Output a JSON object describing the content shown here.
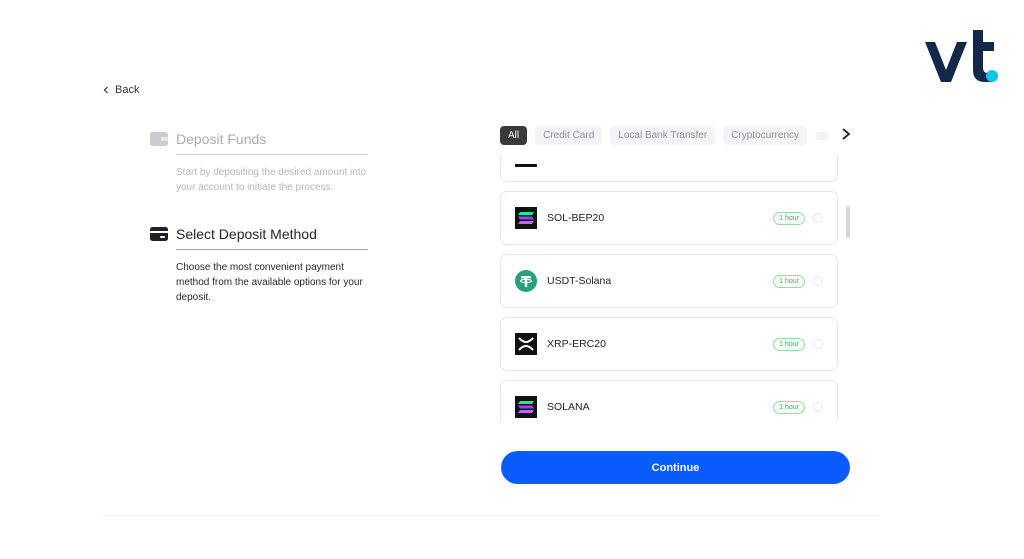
{
  "back_label": "Back",
  "steps": [
    {
      "title": "Deposit Funds",
      "description": "Start by depositing the desired amount into your account to initiate the process.",
      "state": "inactive"
    },
    {
      "title": "Select Deposit Method",
      "description": "Choose the most convenient payment method from the available options for your deposit.",
      "state": "active"
    }
  ],
  "filters": [
    "All",
    "Credit Card",
    "Local Bank Transfer",
    "Cryptocurrency",
    ""
  ],
  "active_filter": "All",
  "methods": [
    {
      "name": "",
      "icon": "partial-icon"
    },
    {
      "name": "SOL-BEP20",
      "icon": "solana-icon",
      "time": "1 hour"
    },
    {
      "name": "USDT-Solana",
      "icon": "tether-icon",
      "time": "1 hour"
    },
    {
      "name": "XRP-ERC20",
      "icon": "xrp-icon",
      "time": "1 hour"
    },
    {
      "name": "SOLANA",
      "icon": "solana-icon",
      "time": "1 hour"
    }
  ],
  "continue_label": "Continue",
  "colors": {
    "primary": "#0b5cff",
    "logo_navy": "#13294b",
    "logo_dot": "#12c4e9",
    "badge_green": "#5aa870",
    "tether_green": "#26a17b"
  }
}
